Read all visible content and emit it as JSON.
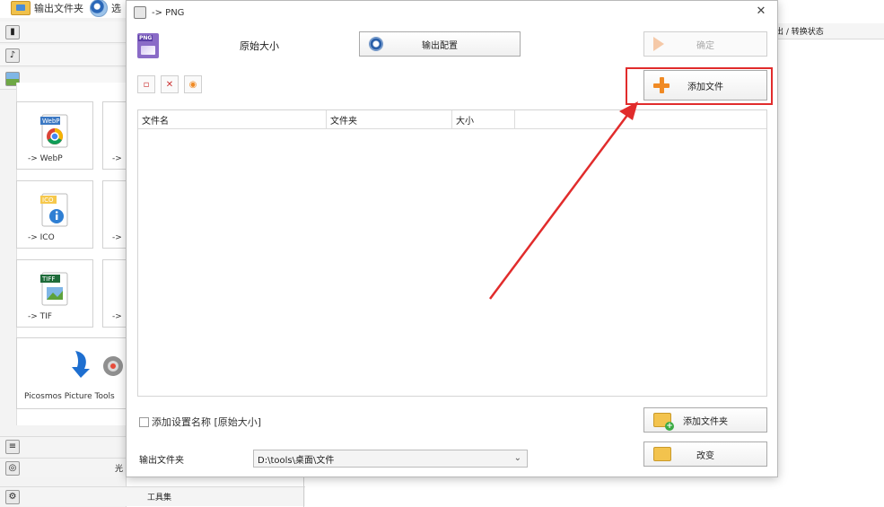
{
  "bg_app": {
    "top_button_label": "输出文件夹",
    "top_button2_partial": "选",
    "right_header": "出 / 转换状态",
    "left_categories": [
      "video",
      "audio",
      "image"
    ],
    "format_cards": [
      "-> WebP",
      "-> ICO",
      "-> TIF"
    ],
    "format_cards_partial": [
      "->",
      "->",
      "->"
    ],
    "webp_badge": "WebP",
    "ico_badge": "ICO",
    "tiff_badge": "TIFF",
    "tools_card": "Picosmos Picture Tools",
    "bottom_rows": [
      "光",
      "工具集"
    ]
  },
  "dialog": {
    "title": "-> PNG",
    "png_badge": "PNG",
    "original_size": "原始大小",
    "output_config_button": "输出配置",
    "confirm_button": "确定",
    "add_file_button": "添加文件",
    "table": {
      "columns": [
        "文件名",
        "文件夹",
        "大小"
      ],
      "rows": []
    },
    "add_setting_name_checkbox": "添加设置名称 [原始大小]",
    "add_folder_button": "添加文件夹",
    "output_folder_label": "输出文件夹",
    "output_folder_value": "D:\\tools\\桌面\\文件",
    "change_button": "改变"
  },
  "colors": {
    "highlight": "#e12c2c",
    "plus_orange": "#f08a24"
  }
}
